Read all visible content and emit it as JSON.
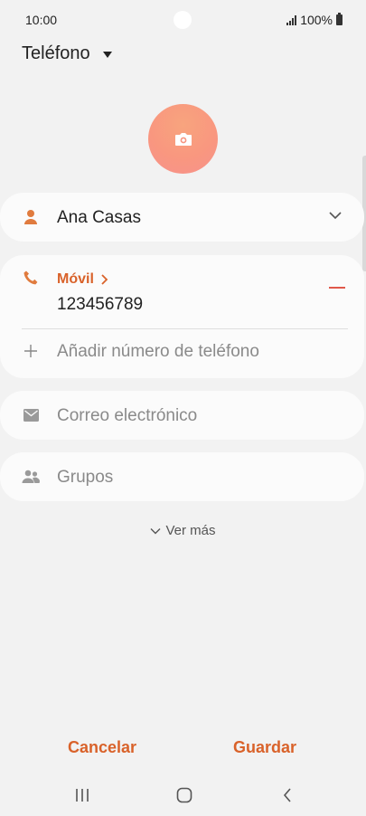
{
  "status_bar": {
    "time": "10:00",
    "battery": "100%"
  },
  "storage": {
    "label": "Teléfono"
  },
  "name": {
    "value": "Ana Casas"
  },
  "phone": {
    "type_label": "Móvil",
    "number": "123456789",
    "add_placeholder": "Añadir número de teléfono"
  },
  "email": {
    "placeholder": "Correo electrónico"
  },
  "groups": {
    "label": "Grupos"
  },
  "see_more": {
    "label": "Ver más"
  },
  "actions": {
    "cancel": "Cancelar",
    "save": "Guardar"
  },
  "colors": {
    "accent": "#d9622a",
    "icon_orange": "#e07b3e",
    "remove_red": "#e0584a",
    "background": "#f2f2f2",
    "card": "#fbfbfb"
  },
  "icons": [
    "camera-icon",
    "person-icon",
    "phone-icon",
    "plus-icon",
    "email-icon",
    "groups-icon",
    "chevron-down-icon",
    "chevron-right-icon",
    "minus-icon",
    "recent-apps-icon",
    "home-icon",
    "back-icon"
  ]
}
